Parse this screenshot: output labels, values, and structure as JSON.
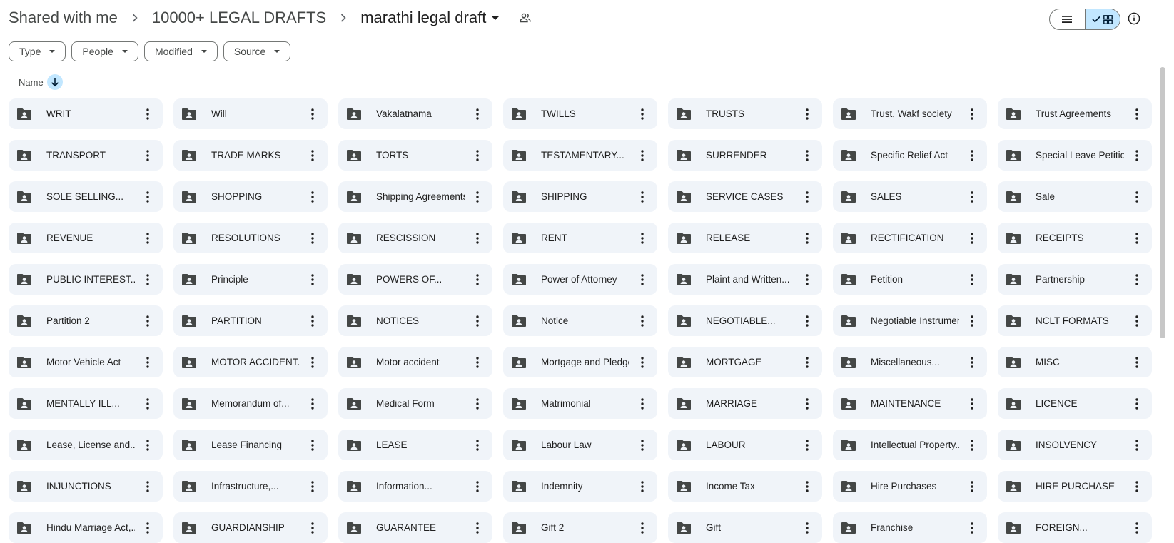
{
  "breadcrumb": {
    "root": "Shared with me",
    "parent": "10000+ LEGAL DRAFTS",
    "current": "marathi legal draft"
  },
  "filters": [
    "Type",
    "People",
    "Modified",
    "Source"
  ],
  "sort": {
    "label": "Name",
    "direction": "descending-arrow"
  },
  "icons": {
    "folder": "shared-folder-icon",
    "more": "more-vert-icon",
    "share": "people-icon",
    "list_view": "list-view-icon",
    "grid_view": "grid-view-icon",
    "info": "info-icon"
  },
  "colors": {
    "accent": "#c2e7ff",
    "tile_bg": "#f0f4f9",
    "text": "#1f1f1f"
  },
  "folders": [
    "WRIT",
    "Will",
    "Vakalatnama",
    "TWILLS",
    "TRUSTS",
    "Trust, Wakf society",
    "Trust Agreements",
    "TRANSPORT",
    "TRADE MARKS",
    "TORTS",
    "TESTAMENTARY...",
    "SURRENDER",
    "Specific Relief Act",
    "Special Leave Petition",
    "SOLE SELLING...",
    "SHOPPING",
    "Shipping Agreements",
    "SHIPPING",
    "SERVICE CASES",
    "SALES",
    "Sale",
    "REVENUE",
    "RESOLUTIONS",
    "RESCISSION",
    "RENT",
    "RELEASE",
    "RECTIFICATION",
    "RECEIPTS",
    "PUBLIC INTEREST...",
    "Principle",
    "POWERS OF...",
    "Power of Attorney",
    "Plaint and Written...",
    "Petition",
    "Partnership",
    "Partition 2",
    "PARTITION",
    "NOTICES",
    "Notice",
    "NEGOTIABLE...",
    "Negotiable Instrument",
    "NCLT FORMATS",
    "Motor Vehicle Act",
    "MOTOR ACCIDENT...",
    "Motor accident",
    "Mortgage and Pledge",
    "MORTGAGE",
    "Miscellaneous...",
    "MISC",
    "MENTALLY ILL...",
    "Memorandum of...",
    "Medical Form",
    "Matrimonial",
    "MARRIAGE",
    "MAINTENANCE",
    "LICENCE",
    "Lease, License and...",
    "Lease Financing",
    "LEASE",
    "Labour Law",
    "LABOUR",
    "Intellectual Property...",
    "INSOLVENCY",
    "INJUNCTIONS",
    "Infrastructure,...",
    "Information...",
    "Indemnity",
    "Income Tax",
    "Hire Purchases",
    "HIRE PURCHASE",
    "Hindu Marriage Act,...",
    "GUARDIANSHIP",
    "GUARANTEE",
    "Gift 2",
    "Gift",
    "Franchise",
    "FOREIGN..."
  ]
}
